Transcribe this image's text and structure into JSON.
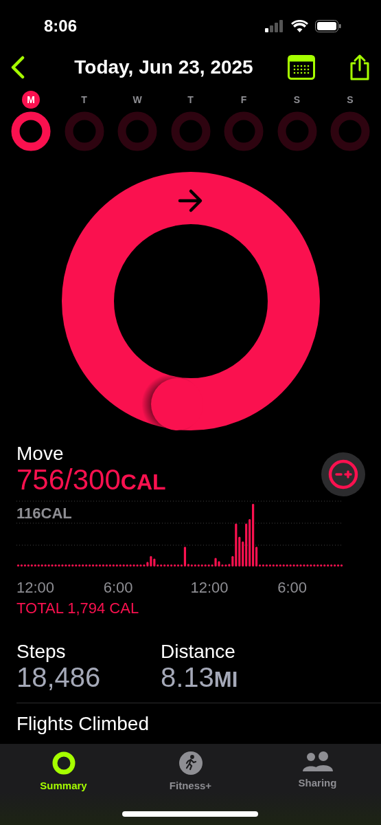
{
  "status_bar": {
    "time": "8:06"
  },
  "header": {
    "title": "Today, Jun 23, 2025"
  },
  "days": [
    {
      "letter": "M",
      "selected": true,
      "level": 1
    },
    {
      "letter": "T",
      "selected": false,
      "level": 0
    },
    {
      "letter": "W",
      "selected": false,
      "level": 0
    },
    {
      "letter": "T",
      "selected": false,
      "level": 0
    },
    {
      "letter": "F",
      "selected": false,
      "level": 0
    },
    {
      "letter": "S",
      "selected": false,
      "level": 0
    },
    {
      "letter": "S",
      "selected": false,
      "level": 0
    }
  ],
  "move": {
    "label": "Move",
    "value": "756/300",
    "unit": "CAL",
    "chart_max": "116CAL",
    "x_labels": [
      "12:00",
      "6:00",
      "12:00",
      "6:00"
    ],
    "total": "TOTAL 1,794 CAL"
  },
  "stats": [
    {
      "label": "Steps",
      "value": "18,486"
    },
    {
      "label": "Distance",
      "value": "8.13",
      "unit": "MI"
    }
  ],
  "next_section": "Flights Climbed",
  "tabs": [
    {
      "label": "Summary",
      "kind": "rings",
      "selected": true
    },
    {
      "label": "Fitness+",
      "kind": "runner",
      "selected": false
    },
    {
      "label": "Sharing",
      "kind": "people",
      "selected": false
    }
  ]
}
